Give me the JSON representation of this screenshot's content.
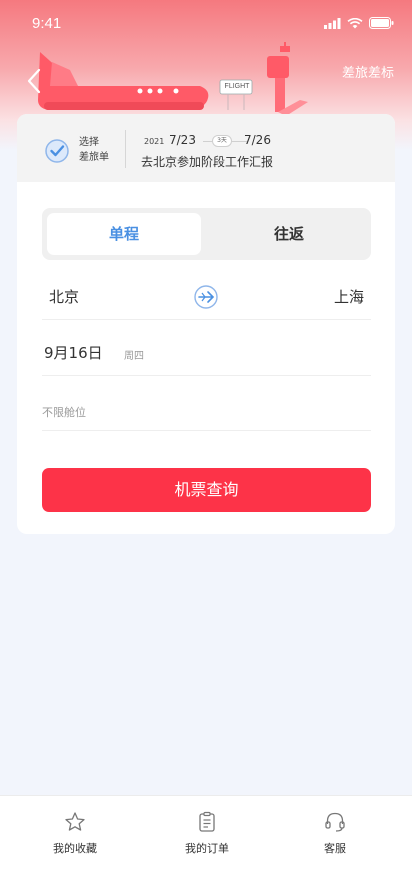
{
  "status_bar": {
    "time": "9:41"
  },
  "header": {
    "right_link": "差旅差标",
    "flight_sign": "FLIGHT"
  },
  "trip": {
    "select_line1": "选择",
    "select_line2": "差旅单",
    "year": "2021",
    "start_date": "7/23",
    "days": "3天",
    "end_date": "7/26",
    "description": "去北京参加阶段工作汇报"
  },
  "tabs": {
    "one_way": "单程",
    "round_trip": "往返"
  },
  "route": {
    "from": "北京",
    "to": "上海"
  },
  "date": {
    "value": "9月16日",
    "weekday": "周四"
  },
  "cabin": {
    "placeholder": "不限舱位"
  },
  "search_button": "机票查询",
  "bottom_nav": {
    "favorites": "我的收藏",
    "orders": "我的订单",
    "service": "客服"
  },
  "colors": {
    "accent_red": "#fd3348",
    "accent_blue": "#4a90e2",
    "hero_pink": "#f5797f"
  }
}
